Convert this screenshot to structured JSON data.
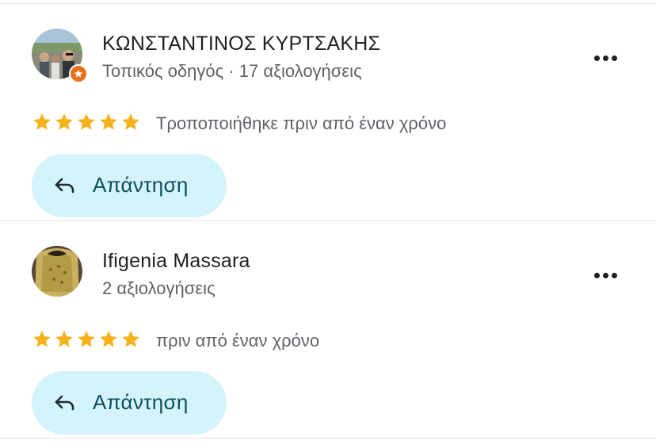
{
  "reviews": [
    {
      "name": "ΚΩΝΣΤΑΝΤΙΝΟΣ ΚΥΡΤΣΑΚΗΣ",
      "meta": "Τοπικός οδηγός · 17 αξιολογήσεις",
      "rating": 5,
      "date": "Τροποποιήθηκε πριν από έναν χρόνο",
      "reply_label": "Απάντηση",
      "local_guide": true
    },
    {
      "name": "Ifigenia Massara",
      "meta": "2 αξιολογήσεις",
      "rating": 5,
      "date": "πριν από έναν χρόνο",
      "reply_label": "Απάντηση",
      "local_guide": false
    }
  ],
  "colors": {
    "star": "#f5b21a",
    "reply_bg": "#d5f3fb",
    "reply_text": "#0b4f5c",
    "badge": "#e8711d"
  }
}
